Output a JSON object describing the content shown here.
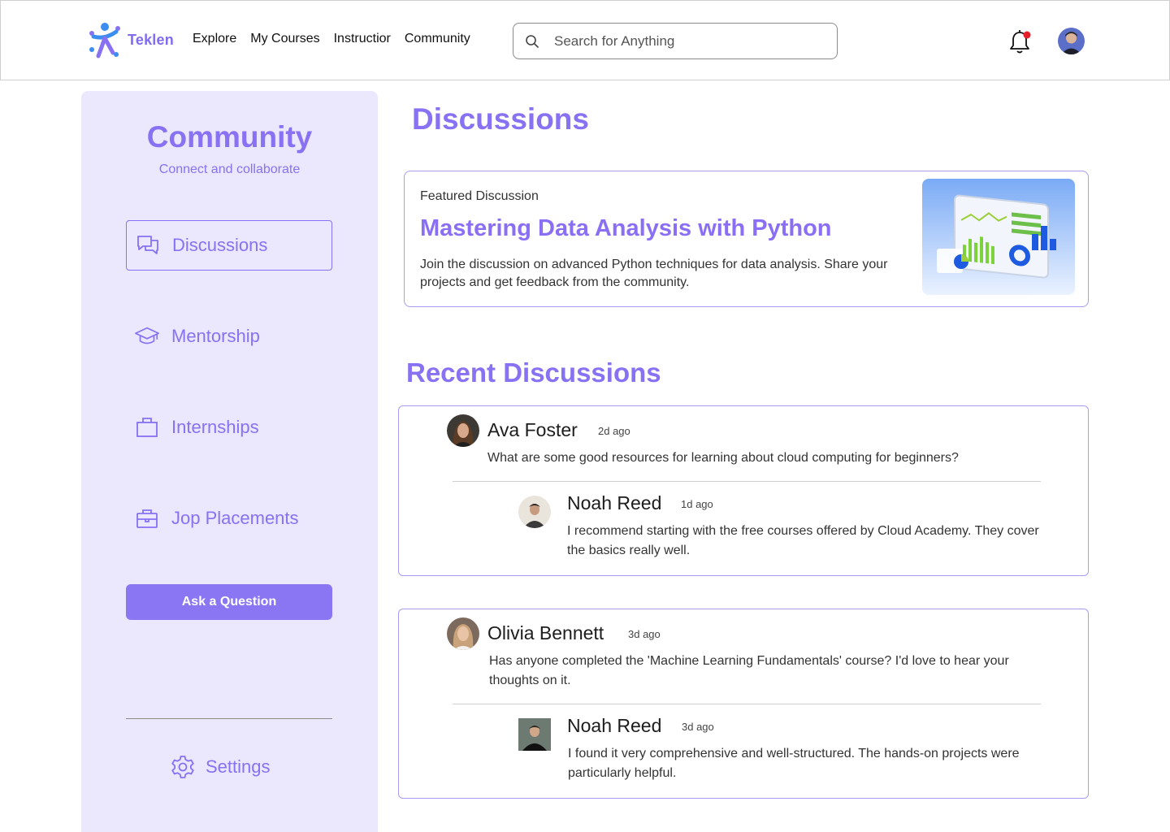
{
  "brand": {
    "name": "Teklen",
    "accent": "#8871f2",
    "sidebar_bg": "#ebe7fd"
  },
  "nav": {
    "items": [
      "Explore",
      "My Courses",
      "Instructior",
      "Community"
    ]
  },
  "search": {
    "placeholder": "Search for Anything"
  },
  "header_icons": {
    "notification": "bell-icon",
    "notification_dot_color": "#e5202a",
    "profile": "user-avatar"
  },
  "sidebar": {
    "title": "Community",
    "subtitle": "Connect and collaborate",
    "items": [
      {
        "label": "Discussions",
        "icon": "chat-bubbles-icon",
        "active": true
      },
      {
        "label": "Mentorship",
        "icon": "graduation-cap-icon",
        "active": false
      },
      {
        "label": "Internships",
        "icon": "bag-icon",
        "active": false
      },
      {
        "label": "Jop Placements",
        "icon": "briefcase-icon",
        "active": false
      }
    ],
    "ask_button": "Ask a Question",
    "settings_label": "Settings"
  },
  "main": {
    "title": "Discussions",
    "featured": {
      "label": "Featured Discussion",
      "title": "Mastering Data Analysis with Python",
      "description": "Join the discussion on advanced Python techniques for data analysis. Share your projects and get feedback from the community."
    },
    "recent_title": "Recent Discussions",
    "threads": [
      {
        "author": "Ava Foster",
        "time": "2d ago",
        "text": "What are some good resources for learning about cloud computing for beginners?",
        "reply": {
          "author": "Noah Reed",
          "time": "1d ago",
          "text": "I recommend starting with the free courses offered by Cloud Academy. They cover the basics really well."
        }
      },
      {
        "author": "Olivia Bennett",
        "time": "3d ago",
        "text": "Has anyone completed the 'Machine Learning Fundamentals' course? I'd love to hear  your thoughts on it.",
        "reply": {
          "author": "Noah Reed",
          "time": "3d ago",
          "text": "I found it very comprehensive and well-structured. The hands-on projects were particularly helpful."
        }
      }
    ]
  }
}
